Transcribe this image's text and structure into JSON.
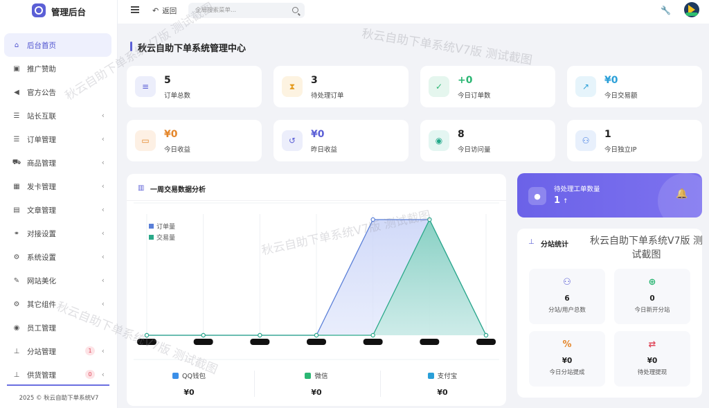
{
  "brand": {
    "title": "管理后台"
  },
  "sidebar": {
    "items": [
      {
        "label": "后台首页",
        "icon": "home-icon",
        "glyph": "⌂",
        "active": true,
        "arrow": false
      },
      {
        "label": "推广赞助",
        "icon": "image-icon",
        "glyph": "▣",
        "arrow": false
      },
      {
        "label": "官方公告",
        "icon": "megaphone-icon",
        "glyph": "◀",
        "arrow": false
      },
      {
        "label": "站长互联",
        "icon": "list-icon",
        "glyph": "☰",
        "arrow": true
      },
      {
        "label": "订单管理",
        "icon": "list-icon",
        "glyph": "☰",
        "arrow": true
      },
      {
        "label": "商品管理",
        "icon": "cart-icon",
        "glyph": "⛟",
        "arrow": true
      },
      {
        "label": "发卡管理",
        "icon": "grid-icon",
        "glyph": "▦",
        "arrow": true
      },
      {
        "label": "文章管理",
        "icon": "book-icon",
        "glyph": "▤",
        "arrow": true
      },
      {
        "label": "对接设置",
        "icon": "handshake-icon",
        "glyph": "⚭",
        "arrow": true
      },
      {
        "label": "系统设置",
        "icon": "gear-icon",
        "glyph": "⚙",
        "arrow": true
      },
      {
        "label": "网站美化",
        "icon": "brush-icon",
        "glyph": "✎",
        "arrow": true
      },
      {
        "label": "其它组件",
        "icon": "cogs-icon",
        "glyph": "⚙",
        "arrow": true
      },
      {
        "label": "员工管理",
        "icon": "user-icon",
        "glyph": "◉",
        "arrow": false
      },
      {
        "label": "分站管理",
        "icon": "sitemap-icon",
        "glyph": "⊥",
        "arrow": true,
        "badge": "1"
      },
      {
        "label": "供货管理",
        "icon": "sitemap-icon",
        "glyph": "⊥",
        "arrow": true,
        "badge": "0"
      }
    ],
    "footer": "2025 © 秋云自助下单系统V7"
  },
  "header": {
    "back_label": "返回",
    "search_placeholder": "全局搜索菜单..."
  },
  "watermark": "秋云自助下单系统V7版 测试截图",
  "page_title": "秋云自助下单系统管理中心",
  "stats": [
    {
      "value": "5",
      "label": "订单总数",
      "icon": "list-ol-icon",
      "glyph": "≡",
      "bg": "#eceefb",
      "fg": "#5b5fd6",
      "value_color": "#222222"
    },
    {
      "value": "3",
      "label": "待处理订单",
      "icon": "hourglass-icon",
      "glyph": "⧗",
      "bg": "#fdf3e1",
      "fg": "#e49b1f",
      "value_color": "#222222"
    },
    {
      "value": "+0",
      "label": "今日订单数",
      "icon": "calendar-check-icon",
      "glyph": "✓",
      "bg": "#e5f6ee",
      "fg": "#2bb673",
      "value_color": "#2bb673"
    },
    {
      "value": "¥0",
      "label": "今日交易额",
      "icon": "chart-line-icon",
      "glyph": "↗",
      "bg": "#e6f4fb",
      "fg": "#2a9fd8",
      "value_color": "#2a9fd8"
    },
    {
      "value": "¥0",
      "label": "今日收益",
      "icon": "money-bill-icon",
      "glyph": "▭",
      "bg": "#fdf0e4",
      "fg": "#e4862a",
      "value_color": "#e4862a"
    },
    {
      "value": "¥0",
      "label": "昨日收益",
      "icon": "history-icon",
      "glyph": "↺",
      "bg": "#eceefb",
      "fg": "#5b5fd6",
      "value_color": "#5b5fd6"
    },
    {
      "value": "8",
      "label": "今日访问量",
      "icon": "eye-icon",
      "glyph": "◉",
      "bg": "#e4f6f2",
      "fg": "#22a98a",
      "value_color": "#222222"
    },
    {
      "value": "1",
      "label": "今日独立IP",
      "icon": "users-icon",
      "glyph": "⚇",
      "bg": "#e8f0fc",
      "fg": "#3b78e0",
      "value_color": "#222222"
    }
  ],
  "chart_card": {
    "title": "一周交易数据分析",
    "payments": [
      {
        "name": "QQ钱包",
        "value": "¥0",
        "icon": "qq-icon",
        "color": "#3b8fe8"
      },
      {
        "name": "微信",
        "value": "¥0",
        "icon": "wechat-icon",
        "color": "#2bb673"
      },
      {
        "name": "支付宝",
        "value": "¥0",
        "icon": "alipay-icon",
        "color": "#2a9fd8"
      }
    ]
  },
  "chart_data": {
    "type": "area",
    "categories": [
      "",
      "",
      "",
      "",
      "",
      "",
      ""
    ],
    "series": [
      {
        "name": "订单量",
        "values": [
          0,
          0,
          0,
          0,
          5,
          5,
          0
        ],
        "color": "#5a7fd8"
      },
      {
        "name": "交易量",
        "values": [
          0,
          0,
          0,
          0,
          0,
          5,
          0
        ],
        "color": "#2aa989"
      }
    ],
    "ylim": [
      0,
      5
    ],
    "grid": true,
    "legend": "top-left"
  },
  "ticket": {
    "label": "待处理工单数量",
    "value": "1",
    "arrow": "↑"
  },
  "substation": {
    "title": "分站统计",
    "tiles": [
      {
        "value": "6",
        "label": "分站/用户总数",
        "icon": "users-icon",
        "glyph": "⚇",
        "color": "#5b5fd6"
      },
      {
        "value": "0",
        "label": "今日新开分站",
        "icon": "plus-circle-icon",
        "glyph": "⊕",
        "color": "#2bb673"
      },
      {
        "value": "¥0",
        "label": "今日分站提成",
        "icon": "percent-icon",
        "glyph": "%",
        "color": "#e4862a"
      },
      {
        "value": "¥0",
        "label": "待处理提现",
        "icon": "exchange-icon",
        "glyph": "⇄",
        "color": "#e04a5c"
      }
    ]
  }
}
